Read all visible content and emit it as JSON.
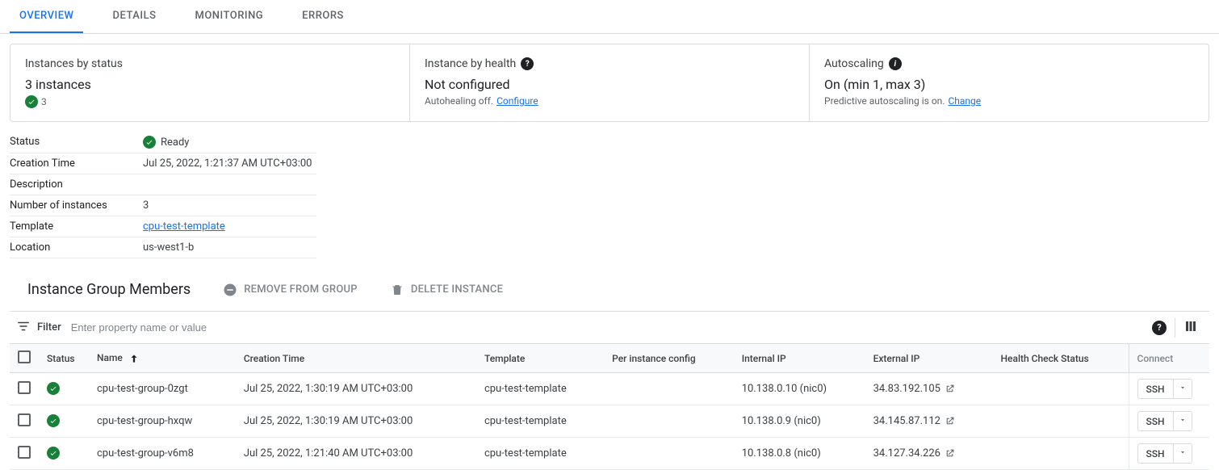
{
  "tabs": [
    "OVERVIEW",
    "DETAILS",
    "MONITORING",
    "ERRORS"
  ],
  "status_card": {
    "title": "Instances by status",
    "main": "3 instances",
    "count": "3"
  },
  "health_card": {
    "title": "Instance by health",
    "main": "Not configured",
    "sub_prefix": "Autohealing off. ",
    "link": "Configure"
  },
  "auto_card": {
    "title": "Autoscaling",
    "main": "On (min 1, max 3)",
    "sub_prefix": "Predictive autoscaling is on. ",
    "link": "Change"
  },
  "props": {
    "status_label": "Status",
    "status_value": "Ready",
    "creation_label": "Creation Time",
    "creation_value": "Jul 25, 2022, 1:21:37 AM UTC+03:00",
    "description_label": "Description",
    "description_value": "",
    "num_label": "Number of instances",
    "num_value": "3",
    "template_label": "Template",
    "template_value": "cpu-test-template",
    "location_label": "Location",
    "location_value": "us-west1-b"
  },
  "members": {
    "title": "Instance Group Members",
    "remove_label": "REMOVE FROM GROUP",
    "delete_label": "DELETE INSTANCE"
  },
  "filter": {
    "label": "Filter",
    "placeholder": "Enter property name or value"
  },
  "columns": {
    "status": "Status",
    "name": "Name",
    "creation": "Creation Time",
    "template": "Template",
    "config": "Per instance config",
    "internal": "Internal IP",
    "external": "External IP",
    "health": "Health Check Status",
    "connect": "Connect"
  },
  "ssh_label": "SSH",
  "rows": [
    {
      "name": "cpu-test-group-0zgt",
      "creation": "Jul 25, 2022, 1:30:19 AM UTC+03:00",
      "template": "cpu-test-template",
      "config": "",
      "internal": "10.138.0.10 (nic0)",
      "external": "34.83.192.105",
      "health": ""
    },
    {
      "name": "cpu-test-group-hxqw",
      "creation": "Jul 25, 2022, 1:30:19 AM UTC+03:00",
      "template": "cpu-test-template",
      "config": "",
      "internal": "10.138.0.9 (nic0)",
      "external": "34.145.87.112",
      "health": ""
    },
    {
      "name": "cpu-test-group-v6m8",
      "creation": "Jul 25, 2022, 1:21:40 AM UTC+03:00",
      "template": "cpu-test-template",
      "config": "",
      "internal": "10.138.0.8 (nic0)",
      "external": "34.127.34.226",
      "health": ""
    }
  ]
}
